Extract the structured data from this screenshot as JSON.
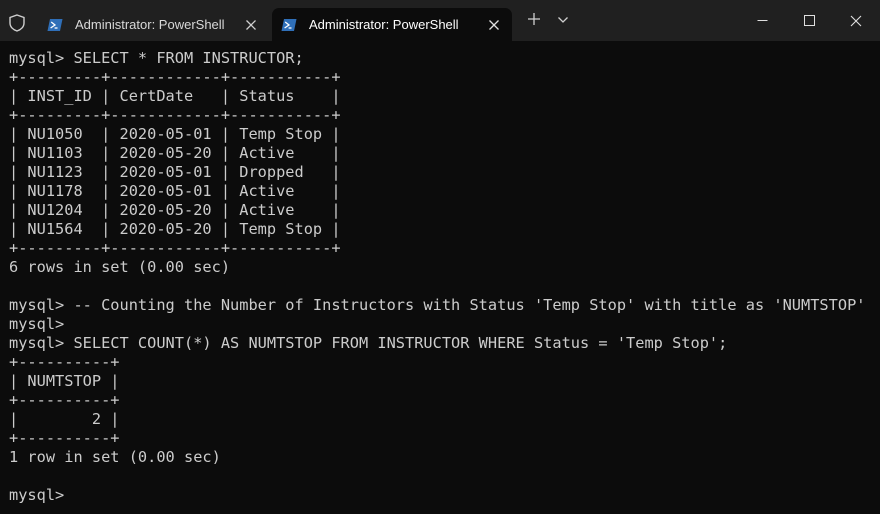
{
  "titlebar": {
    "tabs": [
      {
        "title": "Administrator: PowerShell",
        "active": false
      },
      {
        "title": "Administrator: PowerShell",
        "active": true
      }
    ]
  },
  "terminal": {
    "lines": [
      "mysql> SELECT * FROM INSTRUCTOR;",
      "+---------+------------+-----------+",
      "| INST_ID | CertDate   | Status    |",
      "+---------+------------+-----------+",
      "| NU1050  | 2020-05-01 | Temp Stop |",
      "| NU1103  | 2020-05-20 | Active    |",
      "| NU1123  | 2020-05-01 | Dropped   |",
      "| NU1178  | 2020-05-01 | Active    |",
      "| NU1204  | 2020-05-20 | Active    |",
      "| NU1564  | 2020-05-20 | Temp Stop |",
      "+---------+------------+-----------+",
      "6 rows in set (0.00 sec)",
      "",
      "mysql> -- Counting the Number of Instructors with Status 'Temp Stop' with title as 'NUMTSTOP'",
      "mysql>",
      "mysql> SELECT COUNT(*) AS NUMTSTOP FROM INSTRUCTOR WHERE Status = 'Temp Stop';",
      "+----------+",
      "| NUMTSTOP |",
      "+----------+",
      "|        2 |",
      "+----------+",
      "1 row in set (0.00 sec)",
      "",
      "mysql>"
    ]
  },
  "colors": {
    "background": "#0c0c0c",
    "titlebar": "#202020",
    "text": "#cccccc",
    "powershell_icon": "#2f6fb8"
  }
}
